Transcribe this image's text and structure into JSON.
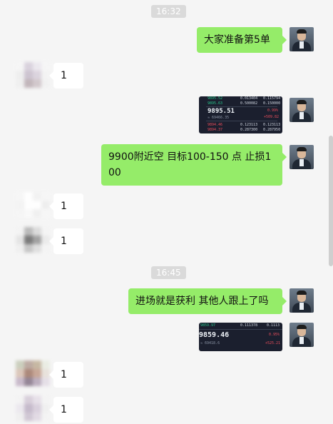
{
  "timestamps": [
    "16:32",
    "16:45"
  ],
  "messages": {
    "m1": "大家准备第5单",
    "m2": "1",
    "m3": "9900附近空  目标100-150 点  止损100",
    "m4": "1",
    "m5": "1",
    "m6": "进场就是获利  其他人跟上了吗",
    "m7": "1",
    "m8": "1"
  },
  "screenshot1": {
    "row1_a": "9895.52",
    "row1_b": "0.013404",
    "row1_c": "0.115794",
    "row2_a": "9895.63",
    "row2_b": "0.500082",
    "row2_c": "0.150000",
    "price": "9895.51",
    "pct": "0.99%",
    "change": "+509.82",
    "sub": "≈ 69466.35",
    "row3_a": "9894.46",
    "row3_b": "0.123113",
    "row3_c": "0.123113",
    "row4_a": "9894.37",
    "row4_b": "0.287300",
    "row4_c": "0.287950"
  },
  "screenshot2": {
    "row1_a": "9859.97",
    "row1_b": "0.111378",
    "row1_c": "0.1113",
    "price": "9859.46",
    "pct": "0.95%",
    "change": "+525.21",
    "sub": "≈ 69418.6"
  },
  "colors": {
    "outgoing": "#95ec69",
    "incoming": "#ffffff",
    "background": "#f5f5f5"
  }
}
